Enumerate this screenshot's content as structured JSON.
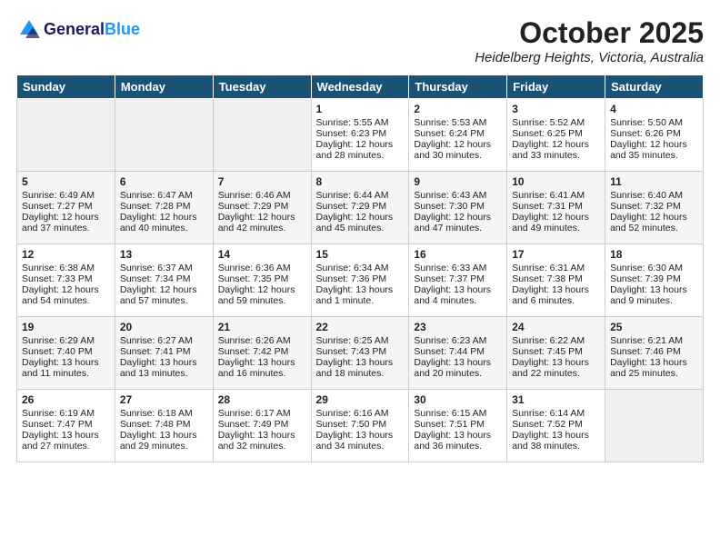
{
  "header": {
    "logo_general": "General",
    "logo_blue": "Blue",
    "month_title": "October 2025",
    "location": "Heidelberg Heights, Victoria, Australia"
  },
  "days_of_week": [
    "Sunday",
    "Monday",
    "Tuesday",
    "Wednesday",
    "Thursday",
    "Friday",
    "Saturday"
  ],
  "weeks": [
    [
      {
        "num": "",
        "content": ""
      },
      {
        "num": "",
        "content": ""
      },
      {
        "num": "",
        "content": ""
      },
      {
        "num": "1",
        "content": "Sunrise: 5:55 AM\nSunset: 6:23 PM\nDaylight: 12 hours\nand 28 minutes."
      },
      {
        "num": "2",
        "content": "Sunrise: 5:53 AM\nSunset: 6:24 PM\nDaylight: 12 hours\nand 30 minutes."
      },
      {
        "num": "3",
        "content": "Sunrise: 5:52 AM\nSunset: 6:25 PM\nDaylight: 12 hours\nand 33 minutes."
      },
      {
        "num": "4",
        "content": "Sunrise: 5:50 AM\nSunset: 6:26 PM\nDaylight: 12 hours\nand 35 minutes."
      }
    ],
    [
      {
        "num": "5",
        "content": "Sunrise: 6:49 AM\nSunset: 7:27 PM\nDaylight: 12 hours\nand 37 minutes."
      },
      {
        "num": "6",
        "content": "Sunrise: 6:47 AM\nSunset: 7:28 PM\nDaylight: 12 hours\nand 40 minutes."
      },
      {
        "num": "7",
        "content": "Sunrise: 6:46 AM\nSunset: 7:29 PM\nDaylight: 12 hours\nand 42 minutes."
      },
      {
        "num": "8",
        "content": "Sunrise: 6:44 AM\nSunset: 7:29 PM\nDaylight: 12 hours\nand 45 minutes."
      },
      {
        "num": "9",
        "content": "Sunrise: 6:43 AM\nSunset: 7:30 PM\nDaylight: 12 hours\nand 47 minutes."
      },
      {
        "num": "10",
        "content": "Sunrise: 6:41 AM\nSunset: 7:31 PM\nDaylight: 12 hours\nand 49 minutes."
      },
      {
        "num": "11",
        "content": "Sunrise: 6:40 AM\nSunset: 7:32 PM\nDaylight: 12 hours\nand 52 minutes."
      }
    ],
    [
      {
        "num": "12",
        "content": "Sunrise: 6:38 AM\nSunset: 7:33 PM\nDaylight: 12 hours\nand 54 minutes."
      },
      {
        "num": "13",
        "content": "Sunrise: 6:37 AM\nSunset: 7:34 PM\nDaylight: 12 hours\nand 57 minutes."
      },
      {
        "num": "14",
        "content": "Sunrise: 6:36 AM\nSunset: 7:35 PM\nDaylight: 12 hours\nand 59 minutes."
      },
      {
        "num": "15",
        "content": "Sunrise: 6:34 AM\nSunset: 7:36 PM\nDaylight: 13 hours\nand 1 minute."
      },
      {
        "num": "16",
        "content": "Sunrise: 6:33 AM\nSunset: 7:37 PM\nDaylight: 13 hours\nand 4 minutes."
      },
      {
        "num": "17",
        "content": "Sunrise: 6:31 AM\nSunset: 7:38 PM\nDaylight: 13 hours\nand 6 minutes."
      },
      {
        "num": "18",
        "content": "Sunrise: 6:30 AM\nSunset: 7:39 PM\nDaylight: 13 hours\nand 9 minutes."
      }
    ],
    [
      {
        "num": "19",
        "content": "Sunrise: 6:29 AM\nSunset: 7:40 PM\nDaylight: 13 hours\nand 11 minutes."
      },
      {
        "num": "20",
        "content": "Sunrise: 6:27 AM\nSunset: 7:41 PM\nDaylight: 13 hours\nand 13 minutes."
      },
      {
        "num": "21",
        "content": "Sunrise: 6:26 AM\nSunset: 7:42 PM\nDaylight: 13 hours\nand 16 minutes."
      },
      {
        "num": "22",
        "content": "Sunrise: 6:25 AM\nSunset: 7:43 PM\nDaylight: 13 hours\nand 18 minutes."
      },
      {
        "num": "23",
        "content": "Sunrise: 6:23 AM\nSunset: 7:44 PM\nDaylight: 13 hours\nand 20 minutes."
      },
      {
        "num": "24",
        "content": "Sunrise: 6:22 AM\nSunset: 7:45 PM\nDaylight: 13 hours\nand 22 minutes."
      },
      {
        "num": "25",
        "content": "Sunrise: 6:21 AM\nSunset: 7:46 PM\nDaylight: 13 hours\nand 25 minutes."
      }
    ],
    [
      {
        "num": "26",
        "content": "Sunrise: 6:19 AM\nSunset: 7:47 PM\nDaylight: 13 hours\nand 27 minutes."
      },
      {
        "num": "27",
        "content": "Sunrise: 6:18 AM\nSunset: 7:48 PM\nDaylight: 13 hours\nand 29 minutes."
      },
      {
        "num": "28",
        "content": "Sunrise: 6:17 AM\nSunset: 7:49 PM\nDaylight: 13 hours\nand 32 minutes."
      },
      {
        "num": "29",
        "content": "Sunrise: 6:16 AM\nSunset: 7:50 PM\nDaylight: 13 hours\nand 34 minutes."
      },
      {
        "num": "30",
        "content": "Sunrise: 6:15 AM\nSunset: 7:51 PM\nDaylight: 13 hours\nand 36 minutes."
      },
      {
        "num": "31",
        "content": "Sunrise: 6:14 AM\nSunset: 7:52 PM\nDaylight: 13 hours\nand 38 minutes."
      },
      {
        "num": "",
        "content": ""
      }
    ]
  ]
}
